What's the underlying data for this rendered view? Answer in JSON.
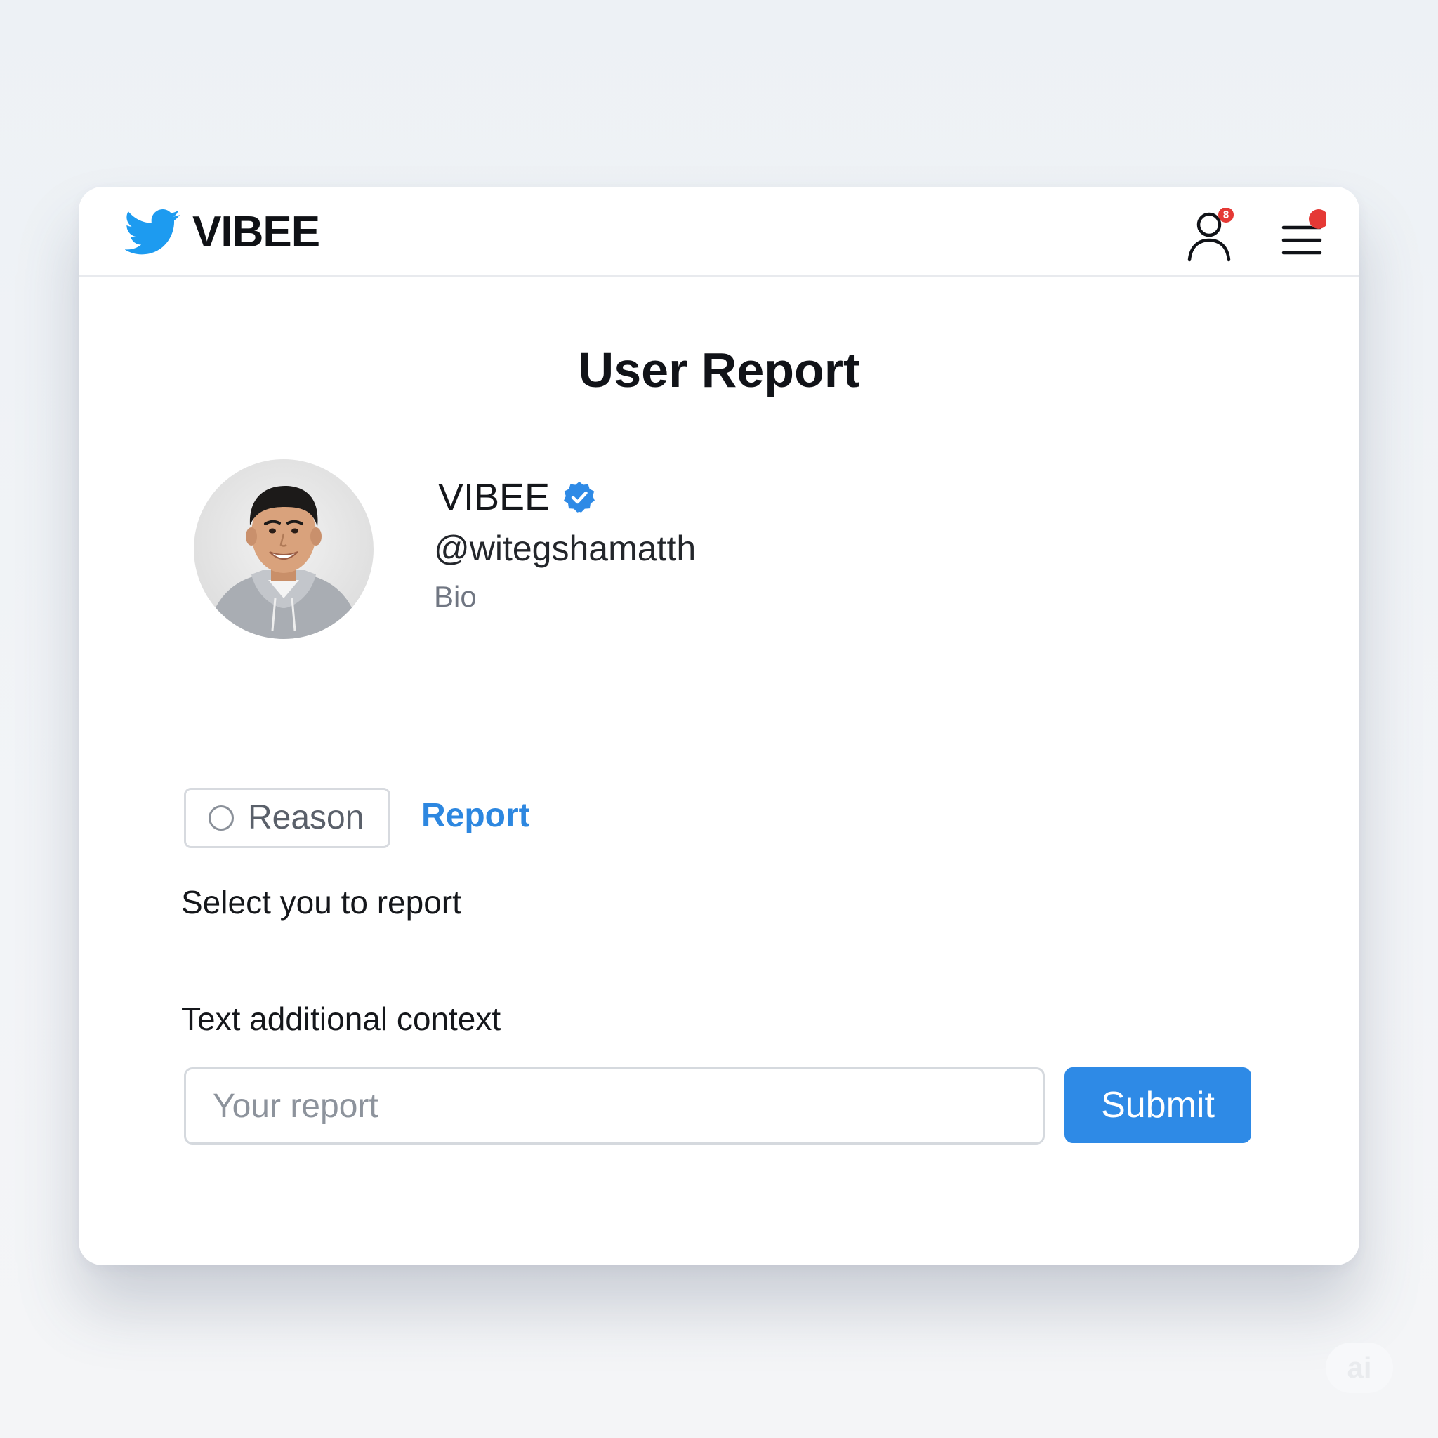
{
  "header": {
    "brand_name": "VIBEE",
    "profile_icon": "user-icon",
    "profile_badge_count": "8",
    "menu_icon": "hamburger-menu-icon",
    "badge_color": "#e53935"
  },
  "main": {
    "title": "User Report"
  },
  "profile": {
    "name": "VIBEE",
    "verified_icon": "verified-badge-icon",
    "handle": "@witegshamatth",
    "bio": "Bio"
  },
  "report_form": {
    "reason_option": "Reason",
    "report_link": "Report",
    "select_prompt": "Select you to report",
    "context_label": "Text additional context",
    "input_placeholder": "Your report",
    "input_value": "",
    "submit_label": "Submit"
  },
  "watermark": "ai",
  "colors": {
    "accent": "#2e8ae6",
    "brand_bird": "#1d9bf0",
    "text_primary": "#111318",
    "text_muted": "#707682"
  }
}
